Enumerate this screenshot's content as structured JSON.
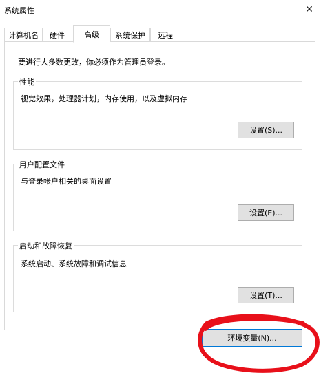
{
  "window": {
    "title": "系统属性",
    "close_glyph": "✕"
  },
  "tabs": [
    {
      "label": "计算机名"
    },
    {
      "label": "硬件"
    },
    {
      "label": "高级",
      "active": true
    },
    {
      "label": "系统保护"
    },
    {
      "label": "远程"
    }
  ],
  "advanced": {
    "notice": "要进行大多数更改，你必须作为管理员登录。",
    "performance": {
      "title": "性能",
      "description": "视觉效果，处理器计划，内存使用，以及虚拟内存",
      "button": "设置(S)..."
    },
    "user_profiles": {
      "title": "用户配置文件",
      "description": "与登录帐户相关的桌面设置",
      "button": "设置(E)..."
    },
    "startup_recovery": {
      "title": "启动和故障恢复",
      "description": "系统启动、系统故障和调试信息",
      "button": "设置(T)..."
    },
    "env_button": "环境变量(N)..."
  },
  "annotation": {
    "color": "#e8101a"
  }
}
